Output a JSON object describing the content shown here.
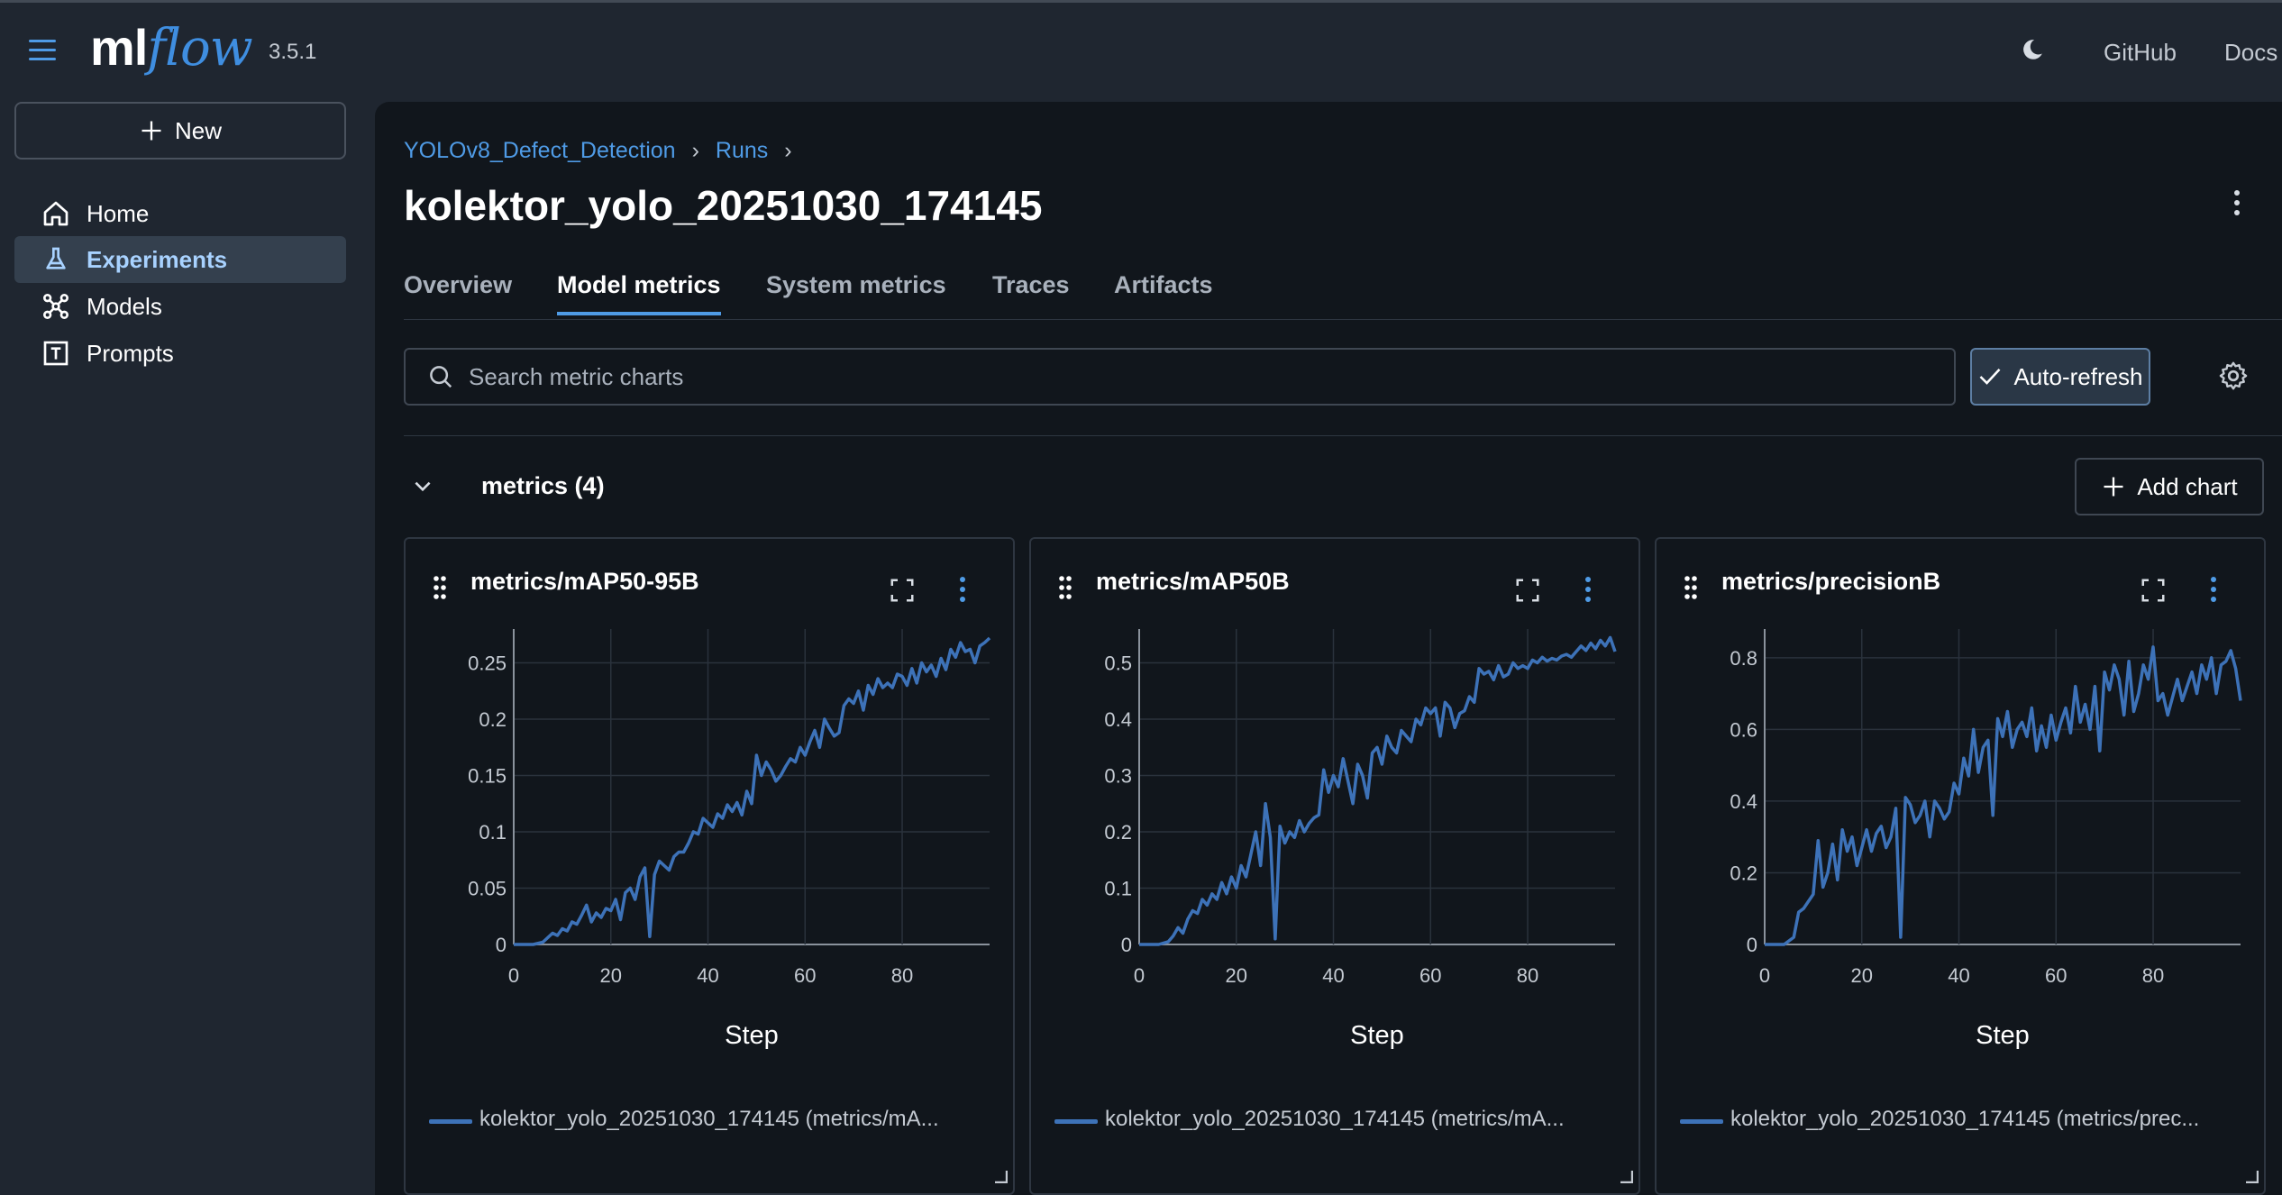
{
  "app": {
    "logo_ml": "ml",
    "logo_flow": "flow",
    "version": "3.5.1",
    "header_links": [
      "GitHub",
      "Docs"
    ]
  },
  "sidebar": {
    "new_label": "New",
    "items": [
      {
        "label": "Home",
        "icon": "home-icon",
        "active": false
      },
      {
        "label": "Experiments",
        "icon": "flask-icon",
        "active": true
      },
      {
        "label": "Models",
        "icon": "models-icon",
        "active": false
      },
      {
        "label": "Prompts",
        "icon": "prompts-icon",
        "active": false
      }
    ]
  },
  "breadcrumb": [
    "YOLOv8_Defect_Detection",
    "Runs"
  ],
  "page_title": "kolektor_yolo_20251030_174145",
  "tabs": [
    {
      "label": "Overview",
      "active": false
    },
    {
      "label": "Model metrics",
      "active": true
    },
    {
      "label": "System metrics",
      "active": false
    },
    {
      "label": "Traces",
      "active": false
    },
    {
      "label": "Artifacts",
      "active": false
    }
  ],
  "search": {
    "placeholder": "Search metric charts",
    "value": ""
  },
  "auto_refresh_label": "Auto-refresh",
  "section": {
    "title": "metrics (4)",
    "add_chart_label": "Add chart"
  },
  "colors": {
    "accent": "#4f9be6",
    "series": "#3d72b8",
    "background": "#11161c",
    "sidebar_bg": "#1f2630"
  },
  "chart_data": [
    {
      "type": "line",
      "title": "metrics/mAP50-95B",
      "xlabel": "Step",
      "ylabel": "",
      "xlim": [
        0,
        98
      ],
      "ylim": [
        0,
        0.28
      ],
      "xticks": [
        0,
        20,
        40,
        60,
        80
      ],
      "yticks": [
        0,
        0.05,
        0.1,
        0.15,
        0.2,
        0.25
      ],
      "ytick_labels": [
        "0",
        "0.05",
        "0.1",
        "0.15",
        "0.2",
        "0.25"
      ],
      "grid": true,
      "legend": "kolektor_yolo_20251030_174145 (metrics/mA...",
      "x": [
        0,
        2,
        4,
        6,
        7,
        8,
        9,
        10,
        11,
        12,
        13,
        14,
        15,
        16,
        17,
        18,
        19,
        20,
        21,
        22,
        23,
        24,
        25,
        26,
        27,
        28,
        29,
        30,
        31,
        32,
        33,
        34,
        35,
        36,
        37,
        38,
        39,
        40,
        41,
        42,
        43,
        44,
        45,
        46,
        47,
        48,
        49,
        50,
        51,
        52,
        53,
        54,
        55,
        56,
        57,
        58,
        59,
        60,
        61,
        62,
        63,
        64,
        65,
        66,
        67,
        68,
        69,
        70,
        71,
        72,
        73,
        74,
        75,
        76,
        77,
        78,
        79,
        80,
        81,
        82,
        83,
        84,
        85,
        86,
        87,
        88,
        89,
        90,
        91,
        92,
        93,
        94,
        95,
        96,
        97,
        98
      ],
      "y": [
        0,
        0,
        0,
        0.002,
        0.006,
        0.01,
        0.008,
        0.014,
        0.012,
        0.02,
        0.018,
        0.026,
        0.035,
        0.02,
        0.028,
        0.024,
        0.032,
        0.03,
        0.04,
        0.022,
        0.046,
        0.05,
        0.04,
        0.06,
        0.068,
        0.007,
        0.062,
        0.074,
        0.07,
        0.066,
        0.078,
        0.082,
        0.082,
        0.09,
        0.1,
        0.098,
        0.112,
        0.108,
        0.104,
        0.116,
        0.112,
        0.124,
        0.118,
        0.126,
        0.115,
        0.136,
        0.125,
        0.168,
        0.15,
        0.162,
        0.155,
        0.145,
        0.15,
        0.158,
        0.165,
        0.162,
        0.175,
        0.168,
        0.18,
        0.19,
        0.175,
        0.2,
        0.192,
        0.185,
        0.188,
        0.212,
        0.218,
        0.214,
        0.225,
        0.208,
        0.23,
        0.222,
        0.236,
        0.228,
        0.232,
        0.228,
        0.24,
        0.238,
        0.23,
        0.245,
        0.232,
        0.25,
        0.242,
        0.248,
        0.238,
        0.254,
        0.244,
        0.262,
        0.255,
        0.268,
        0.26,
        0.262,
        0.25,
        0.265,
        0.268,
        0.272
      ]
    },
    {
      "type": "line",
      "title": "metrics/mAP50B",
      "xlabel": "Step",
      "ylabel": "",
      "xlim": [
        0,
        98
      ],
      "ylim": [
        0,
        0.56
      ],
      "xticks": [
        0,
        20,
        40,
        60,
        80
      ],
      "yticks": [
        0,
        0.1,
        0.2,
        0.3,
        0.4,
        0.5
      ],
      "ytick_labels": [
        "0",
        "0.1",
        "0.2",
        "0.3",
        "0.4",
        "0.5"
      ],
      "grid": true,
      "legend": "kolektor_yolo_20251030_174145 (metrics/mA...",
      "x": [
        0,
        2,
        4,
        6,
        7,
        8,
        9,
        10,
        11,
        12,
        13,
        14,
        15,
        16,
        17,
        18,
        19,
        20,
        21,
        22,
        23,
        24,
        25,
        26,
        27,
        28,
        29,
        30,
        31,
        32,
        33,
        34,
        35,
        36,
        37,
        38,
        39,
        40,
        41,
        42,
        43,
        44,
        45,
        46,
        47,
        48,
        49,
        50,
        51,
        52,
        53,
        54,
        55,
        56,
        57,
        58,
        59,
        60,
        61,
        62,
        63,
        64,
        65,
        66,
        67,
        68,
        69,
        70,
        71,
        72,
        73,
        74,
        75,
        76,
        77,
        78,
        79,
        80,
        81,
        82,
        83,
        84,
        85,
        86,
        87,
        88,
        89,
        90,
        91,
        92,
        93,
        94,
        95,
        96,
        97,
        98
      ],
      "y": [
        0,
        0,
        0,
        0.005,
        0.015,
        0.03,
        0.02,
        0.045,
        0.06,
        0.055,
        0.08,
        0.07,
        0.09,
        0.08,
        0.11,
        0.09,
        0.12,
        0.1,
        0.14,
        0.12,
        0.16,
        0.2,
        0.14,
        0.25,
        0.19,
        0.01,
        0.21,
        0.18,
        0.2,
        0.19,
        0.22,
        0.2,
        0.215,
        0.225,
        0.23,
        0.31,
        0.27,
        0.3,
        0.28,
        0.33,
        0.29,
        0.25,
        0.32,
        0.3,
        0.26,
        0.34,
        0.35,
        0.32,
        0.37,
        0.35,
        0.34,
        0.38,
        0.37,
        0.36,
        0.4,
        0.39,
        0.42,
        0.41,
        0.42,
        0.37,
        0.43,
        0.42,
        0.385,
        0.41,
        0.415,
        0.44,
        0.43,
        0.49,
        0.48,
        0.485,
        0.47,
        0.495,
        0.475,
        0.48,
        0.5,
        0.49,
        0.495,
        0.49,
        0.505,
        0.5,
        0.51,
        0.503,
        0.508,
        0.505,
        0.512,
        0.515,
        0.51,
        0.52,
        0.53,
        0.522,
        0.535,
        0.525,
        0.54,
        0.53,
        0.545,
        0.52
      ]
    },
    {
      "type": "line",
      "title": "metrics/precisionB",
      "xlabel": "Step",
      "ylabel": "",
      "xlim": [
        0,
        98
      ],
      "ylim": [
        0,
        0.88
      ],
      "xticks": [
        0,
        20,
        40,
        60,
        80
      ],
      "yticks": [
        0,
        0.2,
        0.4,
        0.6,
        0.8
      ],
      "ytick_labels": [
        "0",
        "0.2",
        "0.4",
        "0.6",
        "0.8"
      ],
      "grid": true,
      "legend": "kolektor_yolo_20251030_174145 (metrics/prec...",
      "x": [
        0,
        2,
        4,
        6,
        7,
        8,
        9,
        10,
        11,
        12,
        13,
        14,
        15,
        16,
        17,
        18,
        19,
        20,
        21,
        22,
        23,
        24,
        25,
        26,
        27,
        28,
        29,
        30,
        31,
        32,
        33,
        34,
        35,
        36,
        37,
        38,
        39,
        40,
        41,
        42,
        43,
        44,
        45,
        46,
        47,
        48,
        49,
        50,
        51,
        52,
        53,
        54,
        55,
        56,
        57,
        58,
        59,
        60,
        61,
        62,
        63,
        64,
        65,
        66,
        67,
        68,
        69,
        70,
        71,
        72,
        73,
        74,
        75,
        76,
        77,
        78,
        79,
        80,
        81,
        82,
        83,
        84,
        85,
        86,
        87,
        88,
        89,
        90,
        91,
        92,
        93,
        94,
        95,
        96,
        97,
        98
      ],
      "y": [
        0,
        0,
        0,
        0.02,
        0.09,
        0.1,
        0.12,
        0.14,
        0.29,
        0.16,
        0.2,
        0.28,
        0.18,
        0.32,
        0.26,
        0.3,
        0.22,
        0.27,
        0.32,
        0.26,
        0.31,
        0.33,
        0.27,
        0.3,
        0.38,
        0.02,
        0.41,
        0.39,
        0.34,
        0.36,
        0.4,
        0.3,
        0.4,
        0.38,
        0.35,
        0.37,
        0.45,
        0.42,
        0.52,
        0.47,
        0.6,
        0.48,
        0.55,
        0.57,
        0.36,
        0.63,
        0.58,
        0.65,
        0.55,
        0.6,
        0.62,
        0.58,
        0.66,
        0.54,
        0.61,
        0.55,
        0.64,
        0.57,
        0.62,
        0.66,
        0.59,
        0.72,
        0.62,
        0.67,
        0.6,
        0.72,
        0.54,
        0.76,
        0.71,
        0.78,
        0.74,
        0.64,
        0.79,
        0.65,
        0.7,
        0.78,
        0.74,
        0.83,
        0.68,
        0.7,
        0.64,
        0.69,
        0.74,
        0.68,
        0.72,
        0.76,
        0.7,
        0.78,
        0.74,
        0.8,
        0.7,
        0.78,
        0.79,
        0.82,
        0.77,
        0.68
      ]
    }
  ]
}
